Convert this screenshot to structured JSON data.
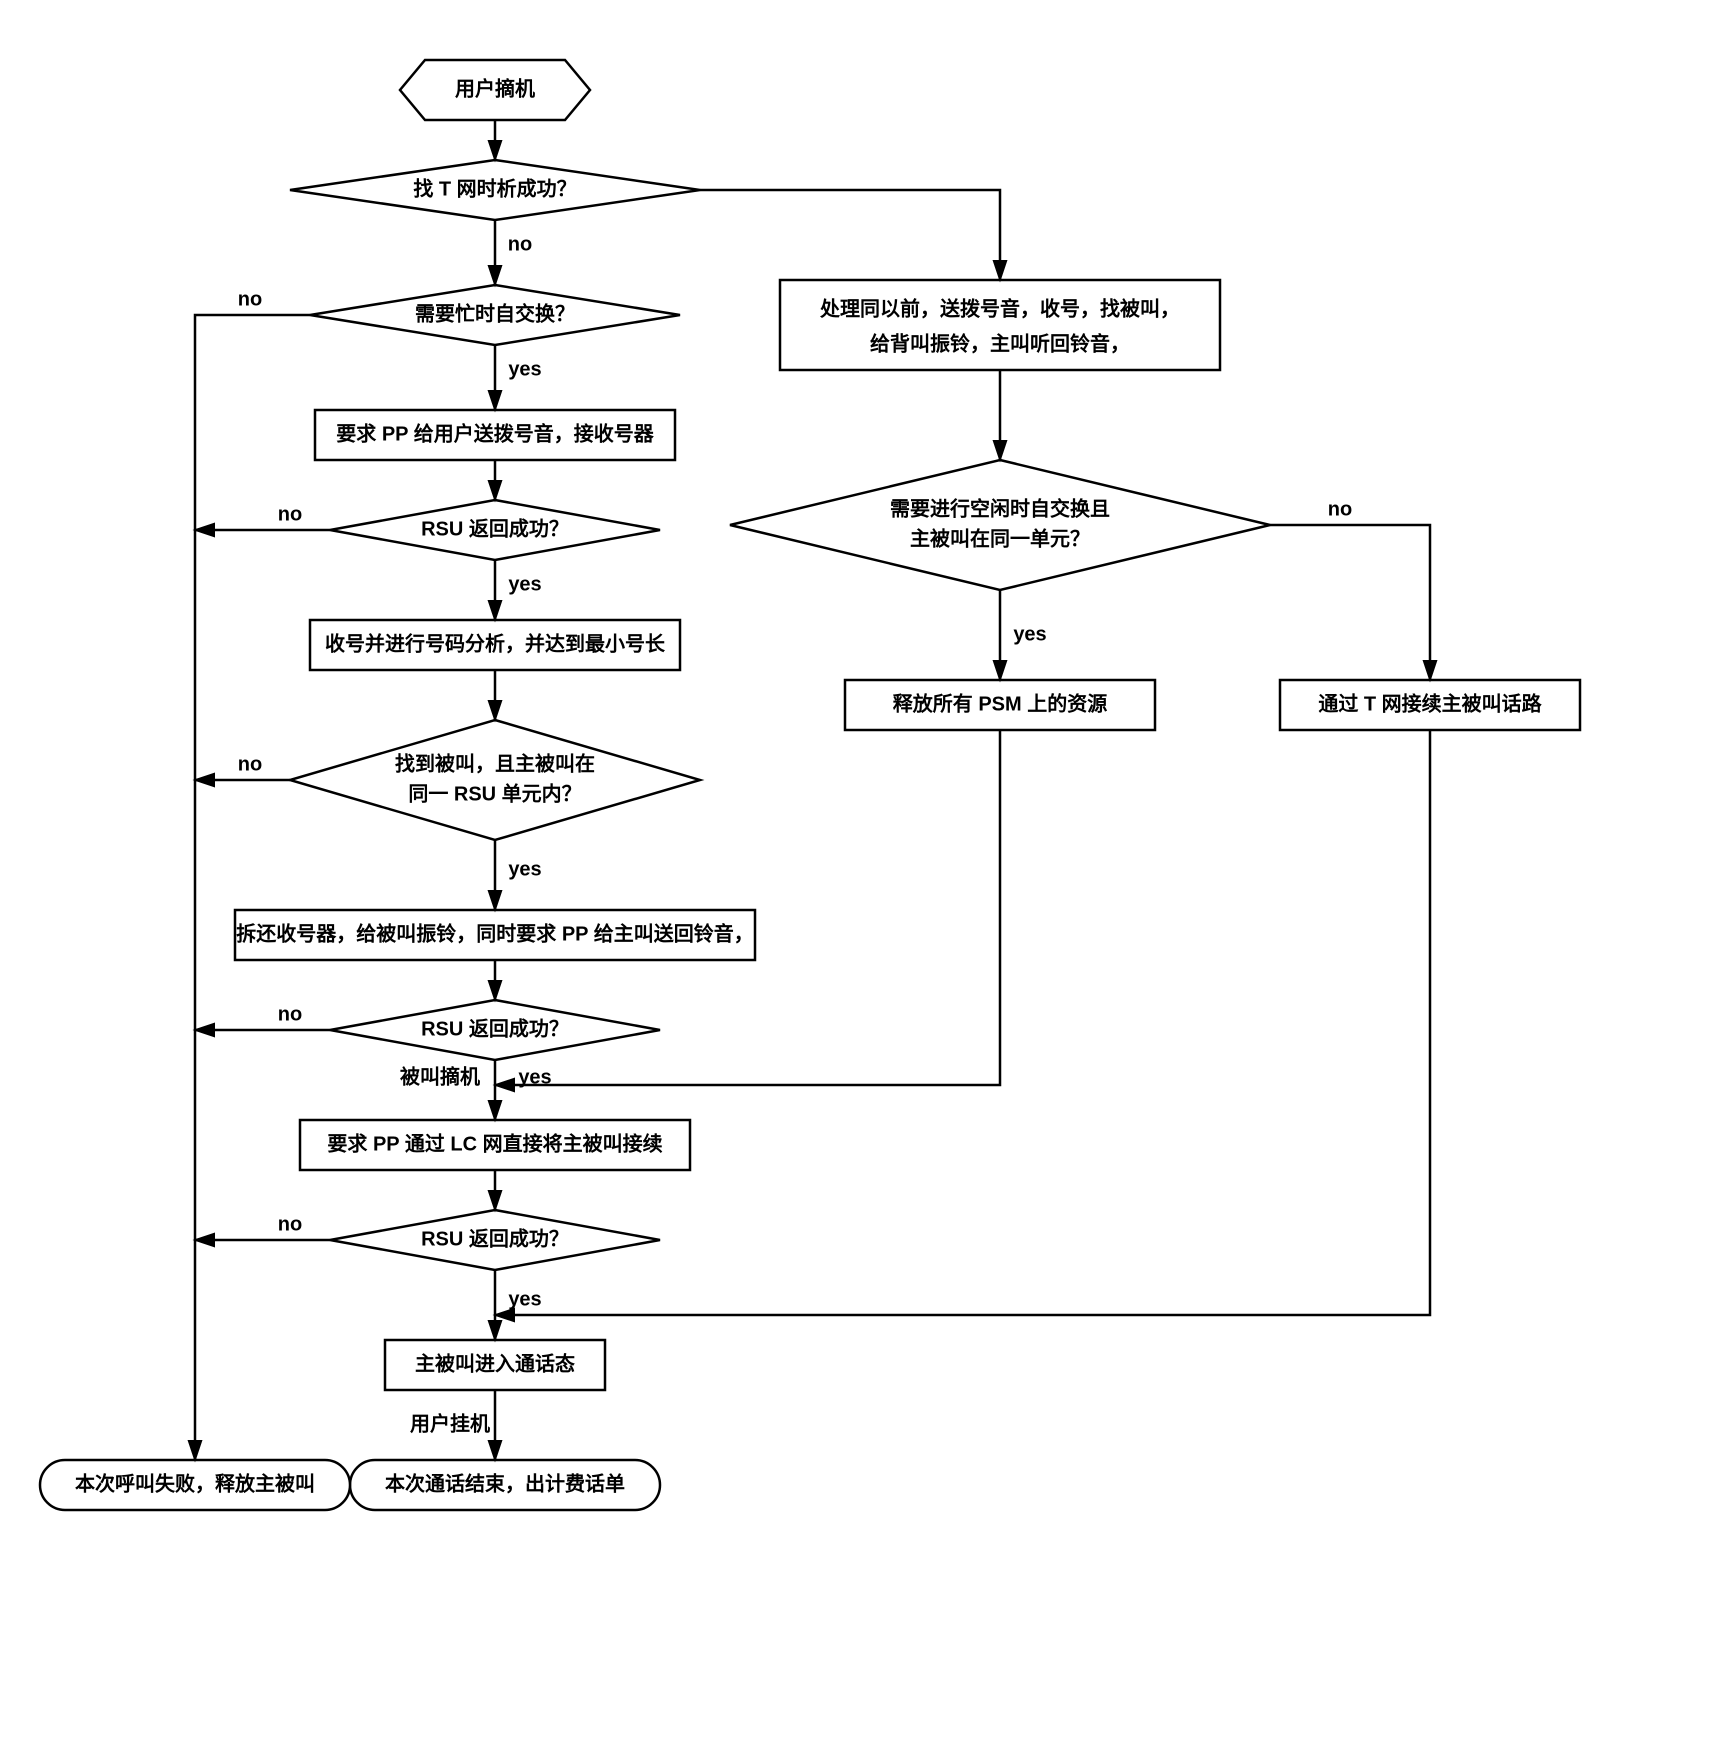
{
  "nodes": {
    "start": "用户摘机",
    "d1": "找 T 网时析成功？",
    "d2": "需要忙时自交换？",
    "p1": "要求 PP 给用户送拨号音，接收号器",
    "d3": "RSU 返回成功？",
    "p2": "收号并进行号码分析，并达到最小号长",
    "d4a": "找到被叫，且主被叫在",
    "d4b": "同一 RSU 单元内？",
    "p3": "拆还收号器，给被叫振铃，同时要求 PP 给主叫送回铃音，",
    "d5": "RSU 返回成功？",
    "p4": "要求 PP 通过 LC 网直接将主被叫接续",
    "d6": "RSU 返回成功？",
    "p5": "主被叫进入通话态",
    "end_ok": "本次通话结束，出计费话单",
    "end_fail": "本次呼叫失败，释放主被叫",
    "rp1a": "处理同以前，送拨号音，收号，找被叫，",
    "rp1b": "给背叫振铃，主叫听回铃音，",
    "rd1a": "需要进行空闲时自交换且",
    "rd1b": "主被叫在同一单元？",
    "rp2": "释放所有 PSM 上的资源",
    "rp3": "通过 T 网接续主被叫话路"
  },
  "labels": {
    "yes": "yes",
    "no": "no",
    "called_offhook": "被叫摘机",
    "user_hangup": "用户挂机"
  }
}
